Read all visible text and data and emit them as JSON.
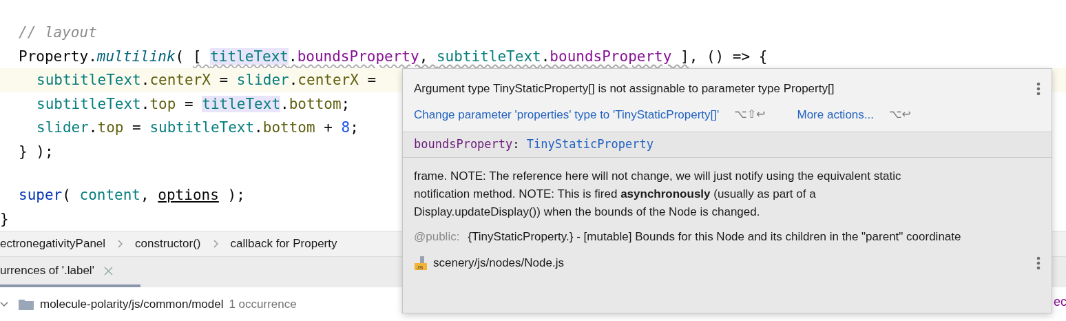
{
  "editor": {
    "lines": [
      {
        "kind": "body",
        "current": false,
        "tokens": [
          {
            "kind": "comment",
            "text": "// layout"
          }
        ]
      },
      {
        "kind": "body",
        "current": false,
        "tokens": [
          {
            "kind": "plain",
            "text": "Property"
          },
          {
            "kind": "plain",
            "text": "."
          },
          {
            "kind": "method",
            "text": "multilink"
          },
          {
            "kind": "plain",
            "text": "( "
          },
          {
            "kind": "warning",
            "children": [
              {
                "kind": "plain",
                "text": "[ "
              },
              {
                "kind": "ref",
                "text": "titleText"
              },
              {
                "kind": "plain",
                "text": "."
              },
              {
                "kind": "field",
                "text": "boundsProperty"
              },
              {
                "kind": "plain",
                "text": ", "
              },
              {
                "kind": "var",
                "text": "subtitleText"
              },
              {
                "kind": "plain",
                "text": "."
              },
              {
                "kind": "field",
                "text": "boundsProperty"
              },
              {
                "kind": "plain",
                "text": " ]"
              }
            ]
          },
          {
            "kind": "plain",
            "text": ", () => {"
          }
        ]
      },
      {
        "kind": "inner",
        "current": true,
        "tokens": [
          {
            "kind": "var",
            "text": "subtitleText"
          },
          {
            "kind": "plain",
            "text": "."
          },
          {
            "kind": "prop",
            "text": "centerX"
          },
          {
            "kind": "plain",
            "text": " = "
          },
          {
            "kind": "var",
            "text": "slider"
          },
          {
            "kind": "plain",
            "text": "."
          },
          {
            "kind": "prop",
            "text": "centerX"
          },
          {
            "kind": "plain",
            "text": " ="
          }
        ]
      },
      {
        "kind": "inner",
        "current": false,
        "tokens": [
          {
            "kind": "var",
            "text": "subtitleText"
          },
          {
            "kind": "plain",
            "text": "."
          },
          {
            "kind": "prop",
            "text": "top"
          },
          {
            "kind": "plain",
            "text": " = "
          },
          {
            "kind": "ref",
            "text": "titleText"
          },
          {
            "kind": "plain",
            "text": "."
          },
          {
            "kind": "prop",
            "text": "bottom"
          },
          {
            "kind": "plain",
            "text": ";"
          }
        ]
      },
      {
        "kind": "inner",
        "current": false,
        "tokens": [
          {
            "kind": "var",
            "text": "slider"
          },
          {
            "kind": "plain",
            "text": "."
          },
          {
            "kind": "prop",
            "text": "top"
          },
          {
            "kind": "plain",
            "text": " = "
          },
          {
            "kind": "var",
            "text": "subtitleText"
          },
          {
            "kind": "plain",
            "text": "."
          },
          {
            "kind": "prop",
            "text": "bottom"
          },
          {
            "kind": "plain",
            "text": " + "
          },
          {
            "kind": "number",
            "text": "8"
          },
          {
            "kind": "plain",
            "text": ";"
          }
        ]
      },
      {
        "kind": "body",
        "current": false,
        "tokens": [
          {
            "kind": "plain",
            "text": "} );"
          }
        ]
      },
      {
        "current": false
      },
      {
        "kind": "body",
        "current": false,
        "tokens": [
          {
            "kind": "keyword",
            "text": "super"
          },
          {
            "kind": "plain",
            "text": "( "
          },
          {
            "kind": "var",
            "text": "content"
          },
          {
            "kind": "plain",
            "text": ", "
          },
          {
            "kind": "param",
            "text": "options"
          },
          {
            "kind": "plain",
            "text": " );"
          }
        ]
      },
      {
        "kind": "outer",
        "current": false,
        "tokens": [
          {
            "kind": "plain",
            "text": "}"
          }
        ]
      }
    ]
  },
  "breadcrumbs": [
    "ectronegativityPanel",
    "constructor()",
    "callback for Property"
  ],
  "tool_tabs": [
    {
      "label": "urrences of '.label'",
      "selected": true
    }
  ],
  "tree_rows": [
    {
      "label": "molecule-polarity/js/common/model",
      "count": "1 occurrence",
      "expanded": true
    }
  ],
  "right_editor": {
    "text": "ec"
  },
  "popup": {
    "message": "Argument type TinyStaticProperty[] is not assignable to parameter type Property[]",
    "actions": [
      {
        "label": "Change parameter 'properties' type to 'TinyStaticProperty[]'",
        "shortcut": "⌥⇧↩"
      },
      {
        "label": "More actions...",
        "shortcut": "⌥↩"
      }
    ],
    "signature": {
      "name": "boundsProperty",
      "separator": ": ",
      "type": "TinyStaticProperty"
    },
    "description": "frame. NOTE: The reference here will not change, we will just notify using the equivalent static notification method. NOTE: This is fired **asynchronously** (usually as part of a Display.updateDisplay()) when the bounds of the Node is changed.",
    "tag": {
      "name": "@public:",
      "text": "{TinyStaticProperty.} - [mutable] Bounds for this Node and its children in the \"parent\" coordinate"
    },
    "file_badge": "JS",
    "file": "scenery/js/nodes/Node.js"
  }
}
